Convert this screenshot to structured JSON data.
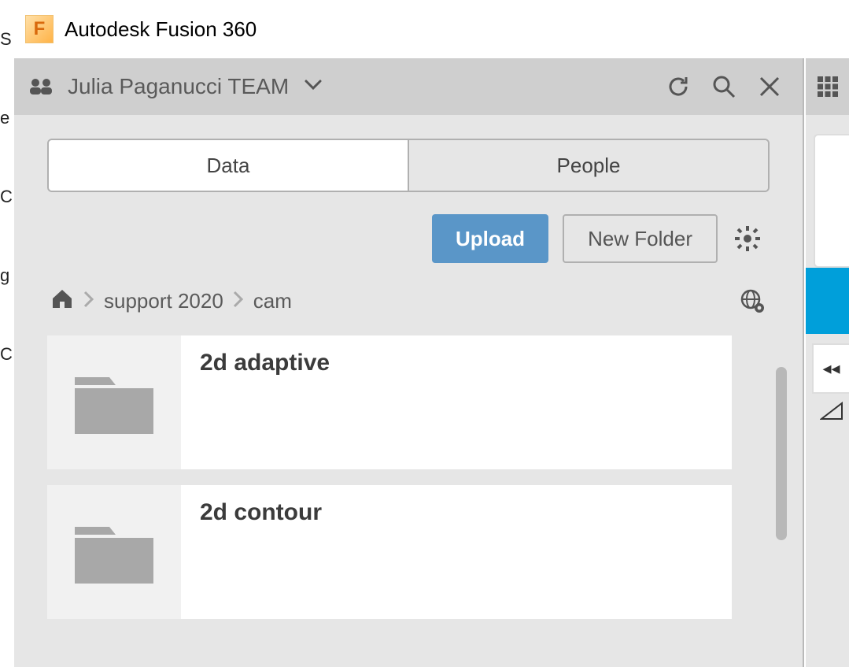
{
  "app": {
    "icon_letter": "F",
    "title": "Autodesk Fusion 360"
  },
  "panel": {
    "team_name": "Julia Paganucci TEAM",
    "tabs": {
      "data": "Data",
      "people": "People"
    },
    "actions": {
      "upload": "Upload",
      "new_folder": "New Folder"
    },
    "breadcrumb": {
      "item1": "support 2020",
      "item2": "cam"
    },
    "folders": [
      {
        "name": "2d adaptive"
      },
      {
        "name": "2d contour"
      }
    ]
  },
  "right": {
    "rewind": "◂◂"
  },
  "left_fringe": "S\n\n\ne\n\n\n\n\nC\n\n\n\n\ng\nC"
}
